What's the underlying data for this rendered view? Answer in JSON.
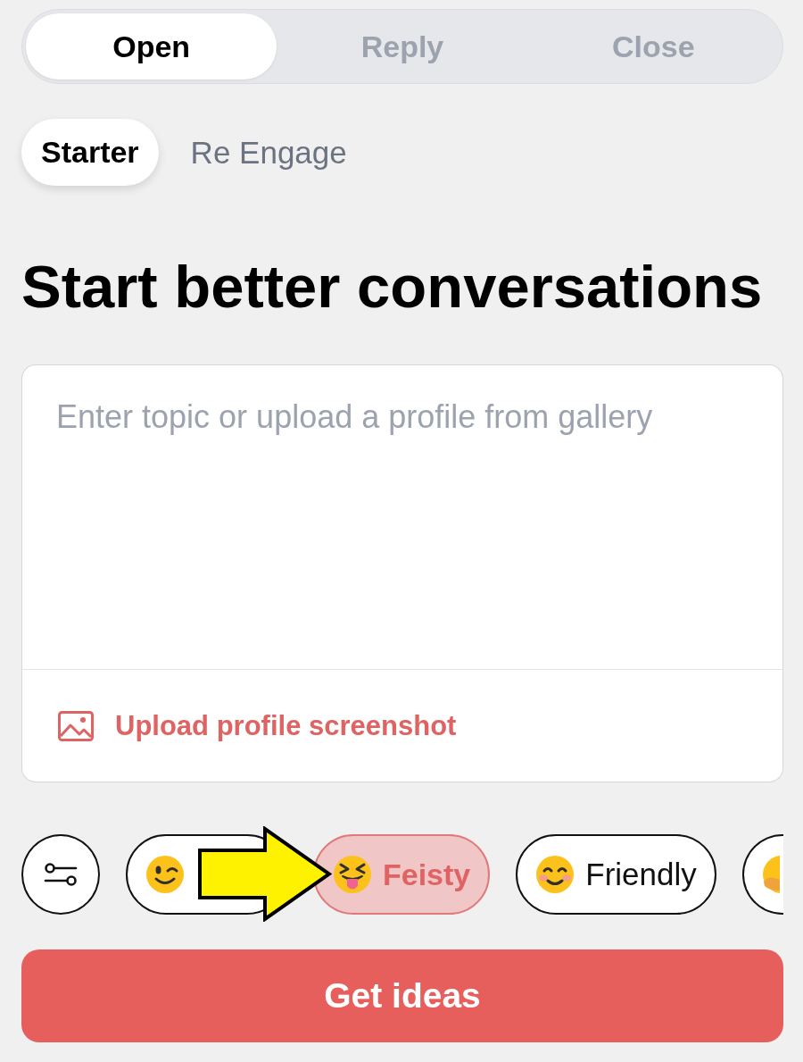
{
  "segments": [
    {
      "label": "Open",
      "selected": true
    },
    {
      "label": "Reply",
      "selected": false
    },
    {
      "label": "Close",
      "selected": false
    }
  ],
  "subtabs": [
    {
      "label": "Starter",
      "selected": true
    },
    {
      "label": "Re Engage",
      "selected": false
    }
  ],
  "heading": "Start better conversations",
  "topic_box": {
    "placeholder": "Enter topic or upload a profile from gallery",
    "upload_label": "Upload profile screenshot"
  },
  "tones": [
    {
      "kind": "wink",
      "selected": false
    },
    {
      "kind": "tongue",
      "label": "Feisty",
      "selected": true
    },
    {
      "kind": "smile",
      "label": "Friendly",
      "selected": false
    },
    {
      "kind": "hand",
      "selected": false
    }
  ],
  "primary_button": "Get ideas"
}
